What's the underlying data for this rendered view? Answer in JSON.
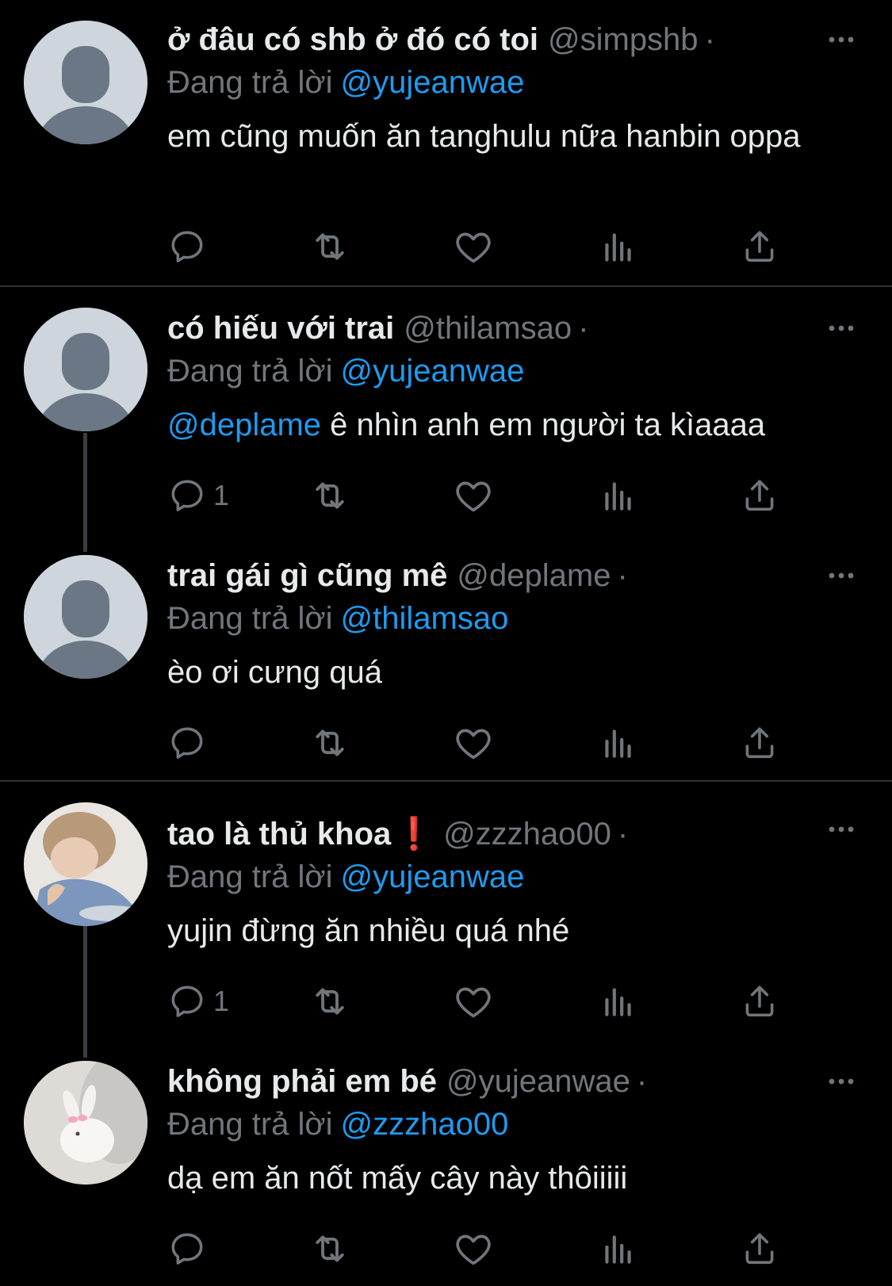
{
  "reply_prefix": "Đang trả lời",
  "tweets": [
    {
      "display_name": "ở đâu có shb ở đó có toi",
      "handle": "@simpshb",
      "dot": "·",
      "reply_to": "@yujeanwae",
      "body": "em cũng muốn ăn tanghulu nữa hanbin oppa",
      "reply_count": ""
    },
    {
      "display_name": "có hiếu với trai",
      "handle": "@thilamsao",
      "dot": "·",
      "reply_to": "@yujeanwae",
      "body_mention": "@deplame",
      "body": " ê nhìn anh em người ta kìaaaa",
      "reply_count": "1"
    },
    {
      "display_name": "trai gái gì cũng mê",
      "handle": "@deplame",
      "dot": "·",
      "reply_to": "@thilamsao",
      "body": "èo ơi cưng quá",
      "reply_count": ""
    },
    {
      "display_name": "tao là thủ khoa",
      "badge": "❗",
      "handle": "@zzzhao00",
      "dot": "·",
      "reply_to": "@yujeanwae",
      "body": "yujin đừng ăn nhiều quá nhé",
      "reply_count": "1"
    },
    {
      "display_name": "không phải em bé",
      "handle": "@yujeanwae",
      "dot": "·",
      "reply_to": "@zzzhao00",
      "body": "dạ em ăn nốt mấy cây này thôiiiii",
      "reply_count": ""
    }
  ],
  "colors": {
    "background": "#000000",
    "text": "#e7e9ea",
    "secondary": "#71767b",
    "link": "#1d9bf0",
    "divider": "#2f3336"
  },
  "icons": [
    "reply-icon",
    "retweet-icon",
    "like-icon",
    "views-icon",
    "share-icon",
    "more-icon"
  ]
}
